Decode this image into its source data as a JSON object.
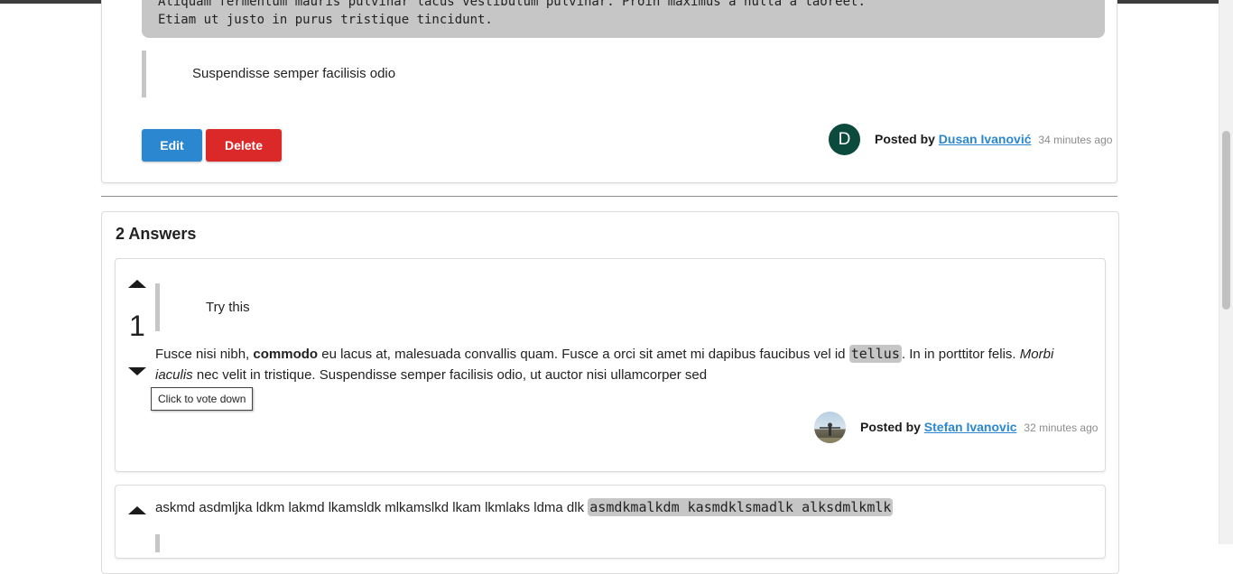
{
  "question": {
    "code_lines": [
      "Aliquam fermentum mauris pulvinar lacus vestibulum pulvinar. Proin maximus a nulla a laoreet.",
      "Etiam ut justo in purus tristique tincidunt."
    ],
    "quote": "Suspendisse semper facilisis odio",
    "edit_label": "Edit",
    "delete_label": "Delete",
    "avatar_initial": "D",
    "posted_by_label": "Posted by",
    "author": "Dusan Ivanović",
    "time": "34 minutes ago"
  },
  "answers": {
    "title": "2 Answers",
    "items": [
      {
        "votes": "1",
        "quote": "Try this",
        "text_before_bold": "Fusce nisi nibh, ",
        "bold": "commodo",
        "text_after_bold": " eu lacus at, malesuada convallis quam. Fusce a orci sit amet mi dapibus faucibus vel id ",
        "code": "tellus",
        "text_after_code": ". In in porttitor felis. ",
        "italic": "Morbi iaculis",
        "text_end": " nec velit in tristique. Suspendisse semper facilisis odio, ut auctor nisi ullamcorper sed",
        "posted_by_label": "Posted by",
        "author": "Stefan Ivanovic",
        "time": "32 minutes ago",
        "tooltip": "Click to vote down"
      },
      {
        "text": "askmd asdmljka ldkm lakmd lkamsldk mlkamslkd lkam lkmlaks ldma dlk ",
        "code": "asmdkmalkdm kasmdklsmadlk alksdmlkmlk"
      }
    ]
  },
  "colors": {
    "primary": "#2a87d0",
    "danger": "#db2828",
    "avatar_bg": "#0b4a3c",
    "code_bg": "#c6c6c6"
  }
}
